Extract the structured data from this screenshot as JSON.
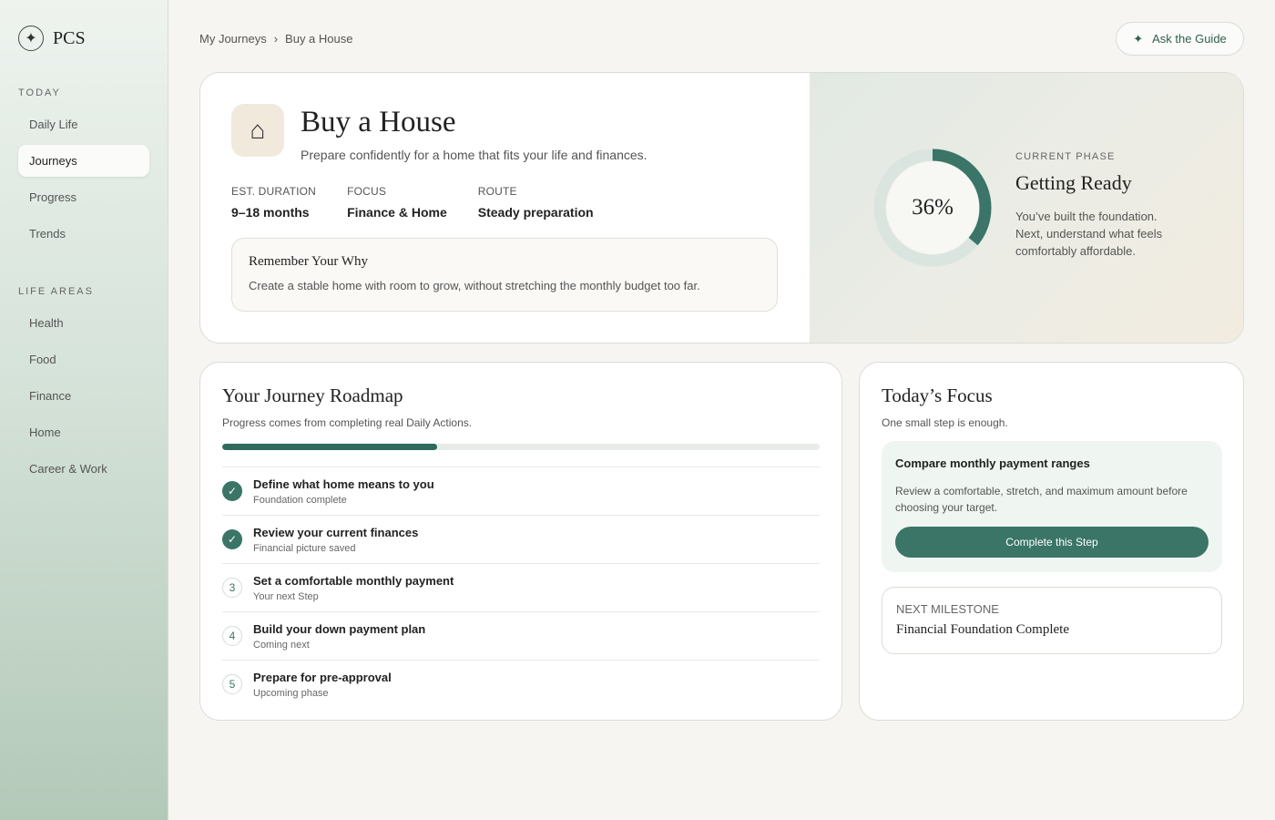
{
  "brand": {
    "icon": "compass-star-icon",
    "name": "PCS"
  },
  "sidebar": {
    "today_title": "TODAY",
    "today_items": [
      {
        "label": "Daily Life",
        "active": false
      },
      {
        "label": "Journeys",
        "active": true
      },
      {
        "label": "Progress",
        "active": false
      },
      {
        "label": "Trends",
        "active": false
      }
    ],
    "life_title": "LIFE AREAS",
    "life_items": [
      {
        "label": "Health"
      },
      {
        "label": "Food"
      },
      {
        "label": "Finance"
      },
      {
        "label": "Home"
      },
      {
        "label": "Career & Work"
      }
    ]
  },
  "breadcrumb": {
    "parent": "My Journeys",
    "separator": "›",
    "current": "Buy a House"
  },
  "ask_button": {
    "icon": "sparkle-icon",
    "label": "Ask the Guide"
  },
  "hero": {
    "icon": "house-icon",
    "title": "Buy a House",
    "subtitle": "Prepare confidently for a home that fits your life and finances.",
    "stats": [
      {
        "label": "EST. DURATION",
        "value": "9–18 months"
      },
      {
        "label": "FOCUS",
        "value": "Finance & Home"
      },
      {
        "label": "ROUTE",
        "value": "Steady preparation"
      }
    ],
    "why": {
      "title": "Remember Your Why",
      "text": "Create a stable home with room to grow, without stretching the monthly budget too far."
    },
    "progress_percent": 36,
    "progress_label": "36%",
    "phase_kicker": "CURRENT PHASE",
    "phase_title": "Getting Ready",
    "phase_text": "You’ve built the foundation. Next, understand what feels comfortably affordable."
  },
  "roadmap": {
    "title": "Your Journey Roadmap",
    "subtitle": "Progress comes from completing real Daily Actions.",
    "progress_fraction": 0.36,
    "steps": [
      {
        "badge": "✓",
        "done": true,
        "title": "Define what home means to you",
        "meta": "Foundation complete"
      },
      {
        "badge": "✓",
        "done": true,
        "title": "Review your current finances",
        "meta": "Financial picture saved"
      },
      {
        "badge": "3",
        "done": false,
        "title": "Set a comfortable monthly payment",
        "meta": "Your next Step"
      },
      {
        "badge": "4",
        "done": false,
        "title": "Build your down payment plan",
        "meta": "Coming next"
      },
      {
        "badge": "5",
        "done": false,
        "title": "Prepare for pre-approval",
        "meta": "Upcoming phase"
      }
    ]
  },
  "focus": {
    "title": "Today’s Focus",
    "subtitle": "One small step is enough.",
    "task_title": "Compare monthly payment ranges",
    "task_text": "Review a comfortable, stretch, and maximum amount before choosing your target.",
    "button_label": "Complete this Step",
    "milestone_kicker": "NEXT MILESTONE",
    "milestone_title": "Financial Foundation Complete"
  },
  "colors": {
    "accent": "#3a7567",
    "ring_track": "#dbe5df",
    "house_tile": "#f1e9dc"
  }
}
